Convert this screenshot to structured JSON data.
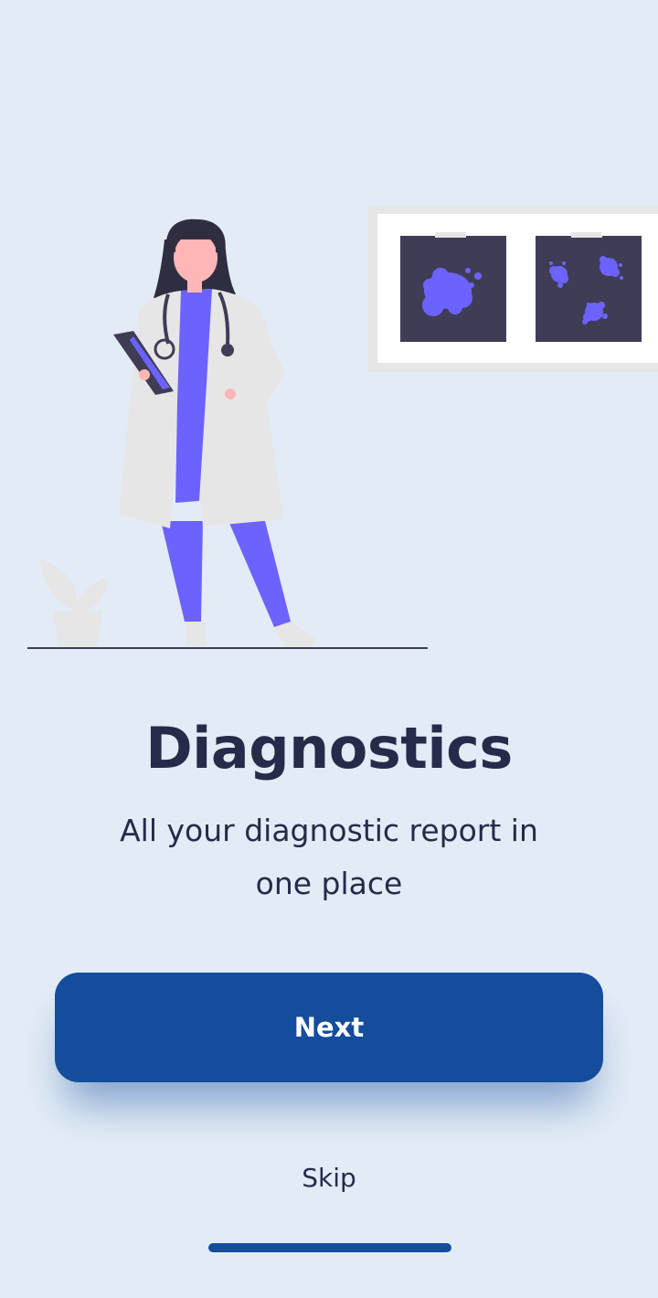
{
  "onboarding": {
    "title": "Diagnostics",
    "subtitle": "All your diagnostic report in one place",
    "next_label": "Next",
    "skip_label": "Skip"
  },
  "illustration": {
    "description_icon": "doctor-with-xray-icon"
  },
  "colors": {
    "background": "#e3ecf6",
    "primary": "#134d9c",
    "text": "#252c4a",
    "accent": "#6c63ff",
    "dark": "#3f3d56",
    "coat": "#e6e6e6"
  }
}
